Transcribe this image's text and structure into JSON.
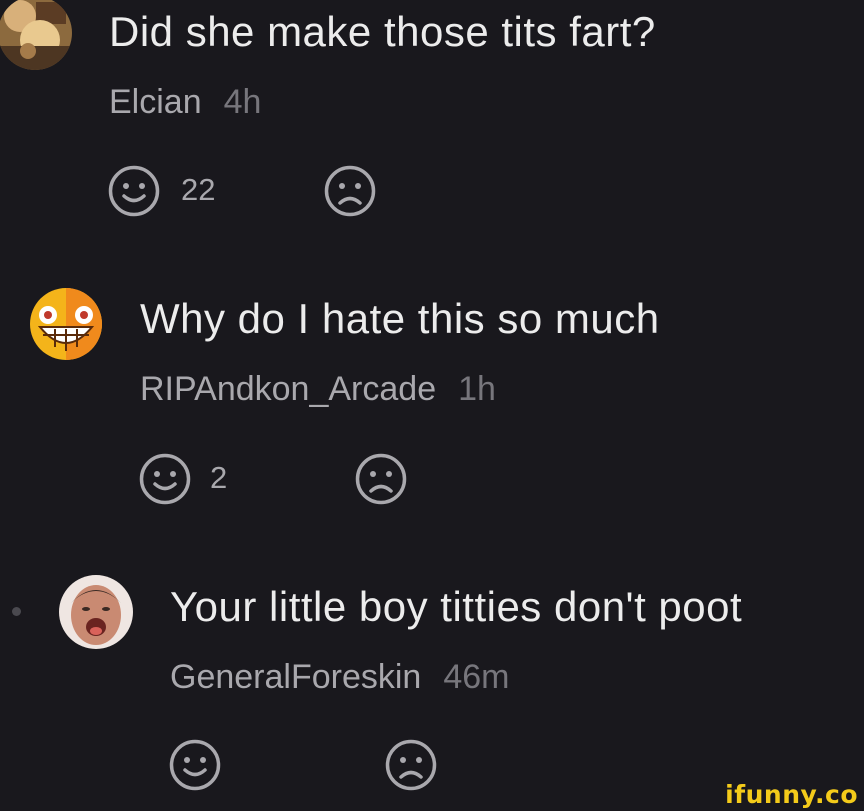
{
  "comments": [
    {
      "text": "Did she make those tits fart?",
      "username": "Elcian",
      "time": "4h",
      "smiles": "22",
      "avatar": "photo-avatar"
    },
    {
      "text": "Why do I hate this so much",
      "username": "RIPAndkon_Arcade",
      "time": "1h",
      "smiles": "2",
      "avatar": "grinning-emoji-avatar"
    },
    {
      "text": "Your little boy titties don't poot",
      "username": "GeneralForeskin",
      "time": "46m",
      "smiles": "",
      "avatar": "photo-avatar"
    }
  ],
  "icons": {
    "smile": "smile-icon",
    "frown": "frown-icon"
  },
  "colors": {
    "background": "#19181d",
    "text": "#ececec",
    "username": "#a9a8ad",
    "time": "#77767c",
    "watermark": "#f4cb1a"
  },
  "watermark": "ifunny.co"
}
